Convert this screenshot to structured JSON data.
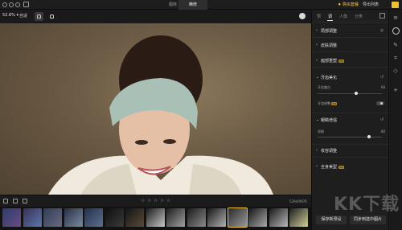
{
  "window": {
    "tabs": [
      {
        "label": "图库"
      },
      {
        "label": "精修"
      }
    ],
    "buy_label": "购买套餐",
    "export_list_label": "导出列表"
  },
  "toolbar": {
    "zoom": "52.6%",
    "fit_label": "自适"
  },
  "right_panel": {
    "tabs": [
      "预",
      "调",
      "人像",
      "分类"
    ],
    "sections": [
      {
        "label": "局部调整",
        "vip": false,
        "icon": "eye-icon"
      },
      {
        "label": "皮肤调整",
        "vip": false
      },
      {
        "label": "面部重塑",
        "vip": true
      },
      {
        "label": "牙齿美化",
        "vip": false,
        "icon": "reset-icon",
        "slider": {
          "label": "牙齿美白",
          "value": "60",
          "level": 0.6
        },
        "toggle": {
          "label": "牙齿修整",
          "vip": true
        }
      },
      {
        "label": "眼睛增强",
        "vip": false,
        "icon": "reset-icon",
        "slider": {
          "label": "亮眼",
          "value": "80",
          "level": 0.8
        }
      },
      {
        "label": "妆容调整",
        "vip": false
      },
      {
        "label": "全身美型",
        "vip": true
      }
    ],
    "vip_badge": "VIP"
  },
  "rating": {
    "stars": 5,
    "counter": "5294/9976"
  },
  "filmstrip": {
    "selected_index": 11
  },
  "buttons": {
    "save_preset": "保存新预设",
    "sync": "同步到选中图片"
  },
  "watermark": "KK下载"
}
